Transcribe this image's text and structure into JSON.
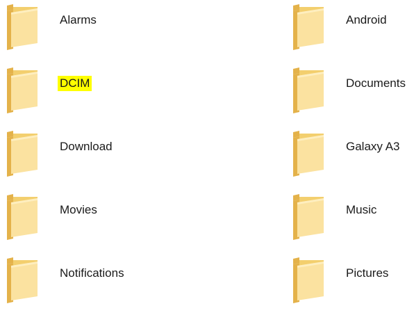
{
  "folders": [
    {
      "label": "Alarms",
      "highlighted": false
    },
    {
      "label": "Android",
      "highlighted": false
    },
    {
      "label": "DCIM",
      "highlighted": true
    },
    {
      "label": "Documents",
      "highlighted": false
    },
    {
      "label": "Download",
      "highlighted": false
    },
    {
      "label": "Galaxy A3",
      "highlighted": false
    },
    {
      "label": "Movies",
      "highlighted": false
    },
    {
      "label": "Music",
      "highlighted": false
    },
    {
      "label": "Notifications",
      "highlighted": false
    },
    {
      "label": "Pictures",
      "highlighted": false
    }
  ],
  "icon": "folder-icon",
  "colors": {
    "folder_light": "#fbe2a0",
    "folder_mid": "#f3cf6e",
    "folder_dark": "#e4b24a",
    "highlight": "#ffff00"
  }
}
